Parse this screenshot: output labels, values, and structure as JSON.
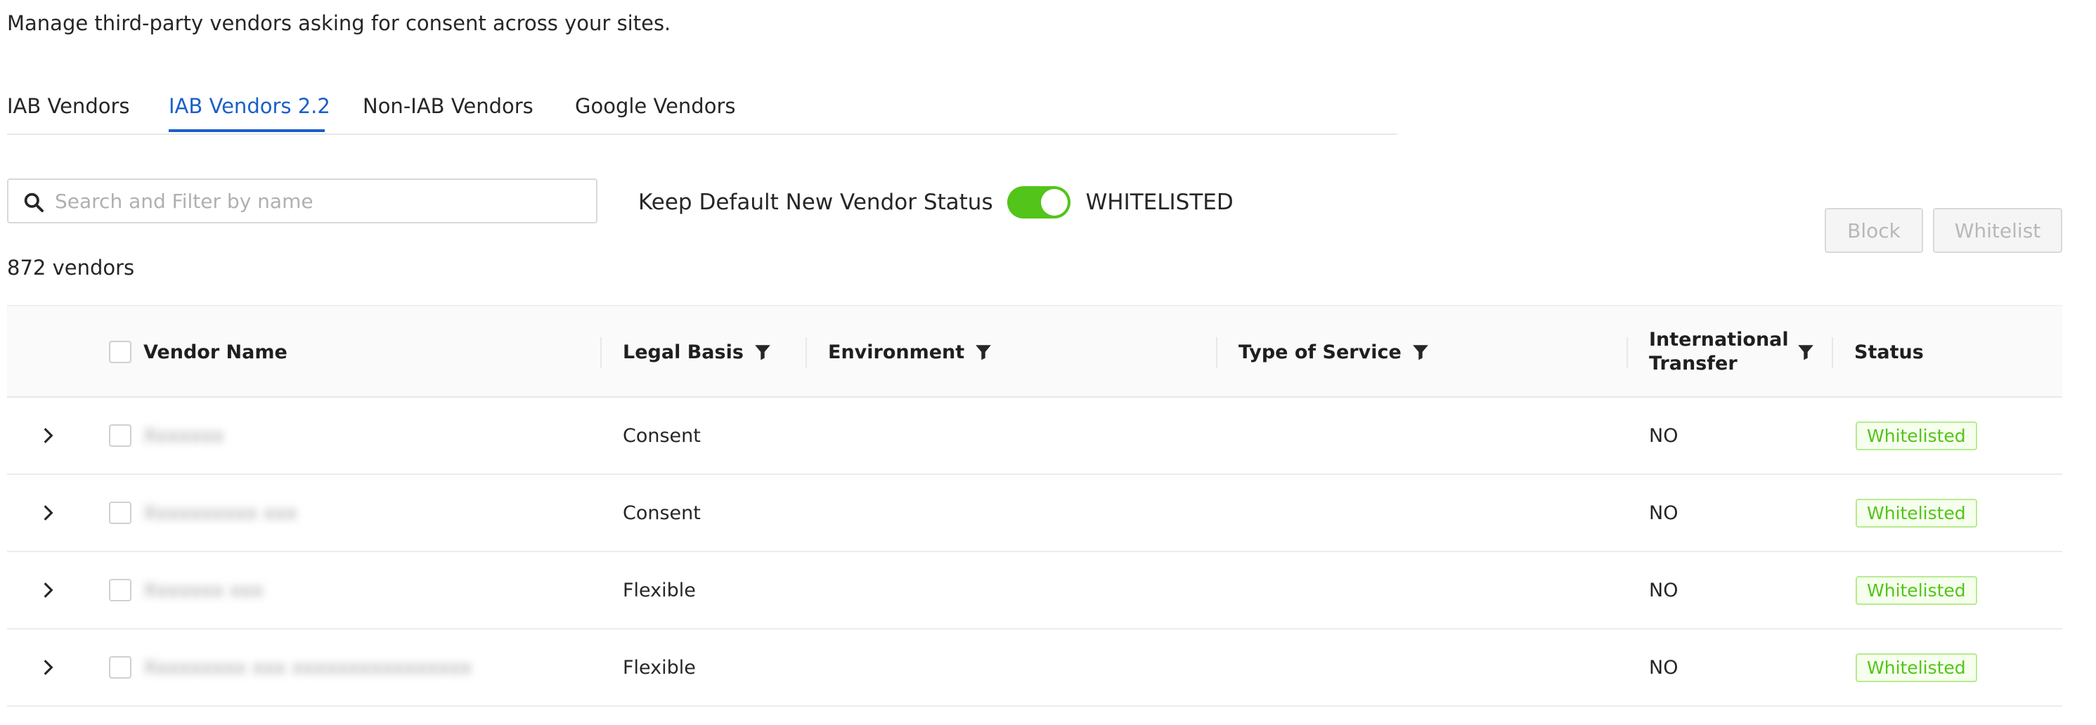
{
  "header": {
    "subtitle": "Manage third-party vendors asking for consent across your sites."
  },
  "tabs": [
    {
      "label": "IAB Vendors",
      "active": false
    },
    {
      "label": "IAB Vendors 2.2",
      "active": true
    },
    {
      "label": "Non-IAB Vendors",
      "active": false
    },
    {
      "label": "Google Vendors",
      "active": false
    }
  ],
  "search": {
    "placeholder": "Search and Filter by name",
    "value": ""
  },
  "default_status": {
    "label": "Keep Default New Vendor Status",
    "value": "WHITELISTED",
    "enabled": true
  },
  "actions": {
    "block_label": "Block",
    "whitelist_label": "Whitelist"
  },
  "vendor_count": "872 vendors",
  "table": {
    "headers": {
      "vendor_name": "Vendor Name",
      "legal_basis": "Legal Basis",
      "environment": "Environment",
      "type_of_service": "Type of Service",
      "international_transfer": "International Transfer",
      "status": "Status"
    },
    "rows": [
      {
        "name": "Xxxxxxx",
        "legal_basis": "Consent",
        "environment": "",
        "type_of_service": "",
        "international_transfer": "NO",
        "status": "Whitelisted"
      },
      {
        "name": "Xxxxxxxxxx xxx",
        "legal_basis": "Consent",
        "environment": "",
        "type_of_service": "",
        "international_transfer": "NO",
        "status": "Whitelisted"
      },
      {
        "name": "Xxxxxxx xxx",
        "legal_basis": "Flexible",
        "environment": "",
        "type_of_service": "",
        "international_transfer": "NO",
        "status": "Whitelisted"
      },
      {
        "name": "Xxxxxxxxx xxx xxxxxxxxxxxxxxxx",
        "legal_basis": "Flexible",
        "environment": "",
        "type_of_service": "",
        "international_transfer": "NO",
        "status": "Whitelisted"
      }
    ]
  },
  "colors": {
    "accent": "#1a5fc8",
    "toggle_on": "#52c41a",
    "status_green": "#52c41a"
  }
}
